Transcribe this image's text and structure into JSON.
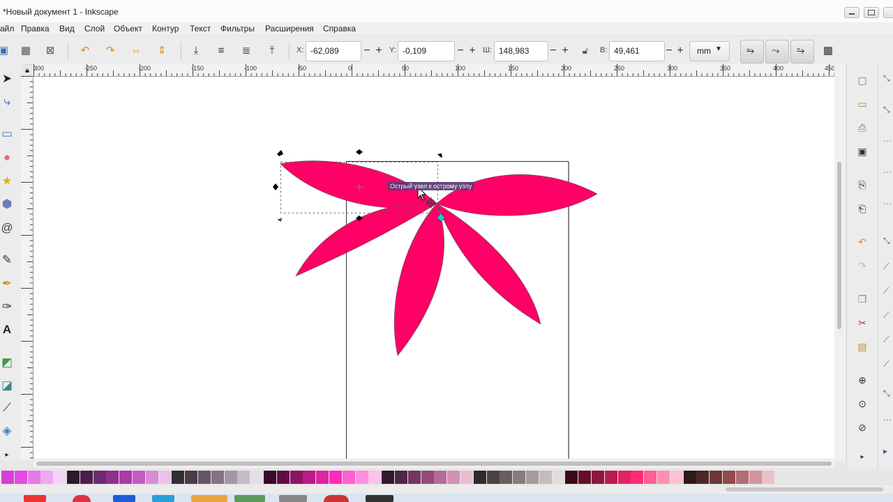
{
  "window": {
    "title": "*Новый документ 1 - Inkscape"
  },
  "menu": [
    "айл",
    "Правка",
    "Вид",
    "Слой",
    "Объект",
    "Контур",
    "Текст",
    "Фильтры",
    "Расширения",
    "Справка"
  ],
  "toolbar": {
    "x_label": "X:",
    "x_value": "-62,089",
    "y_label": "Y:",
    "y_value": "-0,109",
    "w_label": "Ш:",
    "w_value": "148,983",
    "h_label": "В:",
    "h_value": "49,461",
    "unit": "mm",
    "minus": "−",
    "plus": "+"
  },
  "ruler": {
    "labels": [
      "300",
      "-250",
      "-200",
      "-150",
      "-100",
      "-50",
      "0",
      "50",
      "100",
      "150",
      "200",
      "250",
      "300",
      "350",
      "400",
      "450"
    ]
  },
  "canvas": {
    "tooltip": "Острый узел к острому узлу",
    "flower_color": "#ff0066"
  },
  "palette": {
    "colors": [
      "#d63fd6",
      "#e04be0",
      "#e57ae5",
      "#f0a8f0",
      "#f6d3f6",
      "#2a1a2a",
      "#4b1f4b",
      "#6e2a6e",
      "#8e2f8e",
      "#ab3aab",
      "#c45bc4",
      "#d88cd8",
      "#ebc1eb",
      "#303030",
      "#4a3b4a",
      "#665566",
      "#837383",
      "#a397a3",
      "#c4bcc4",
      "#e4dfe4",
      "#3a0a2a",
      "#600f45",
      "#8e1566",
      "#b81c85",
      "#e024a3",
      "#ff2bbf",
      "#ff5fcf",
      "#ff8fdc",
      "#ffc0ec",
      "#301a2e",
      "#4e2648",
      "#71375f",
      "#944a7a",
      "#b56b98",
      "#d191b4",
      "#e8bfd2",
      "#2d2b2b",
      "#4b4343",
      "#685e5e",
      "#877b7b",
      "#a59b9b",
      "#c4bcbc",
      "#e0dcdc",
      "#3a0a1a",
      "#630f2b",
      "#8e1540",
      "#b81c53",
      "#e02466",
      "#ff2b77",
      "#ff5f95",
      "#ff8fb2",
      "#ffc0d3",
      "#2e1a1a",
      "#4c2626",
      "#6e3737",
      "#91494d",
      "#b46b73",
      "#d1949b",
      "#ebc2c6"
    ]
  }
}
